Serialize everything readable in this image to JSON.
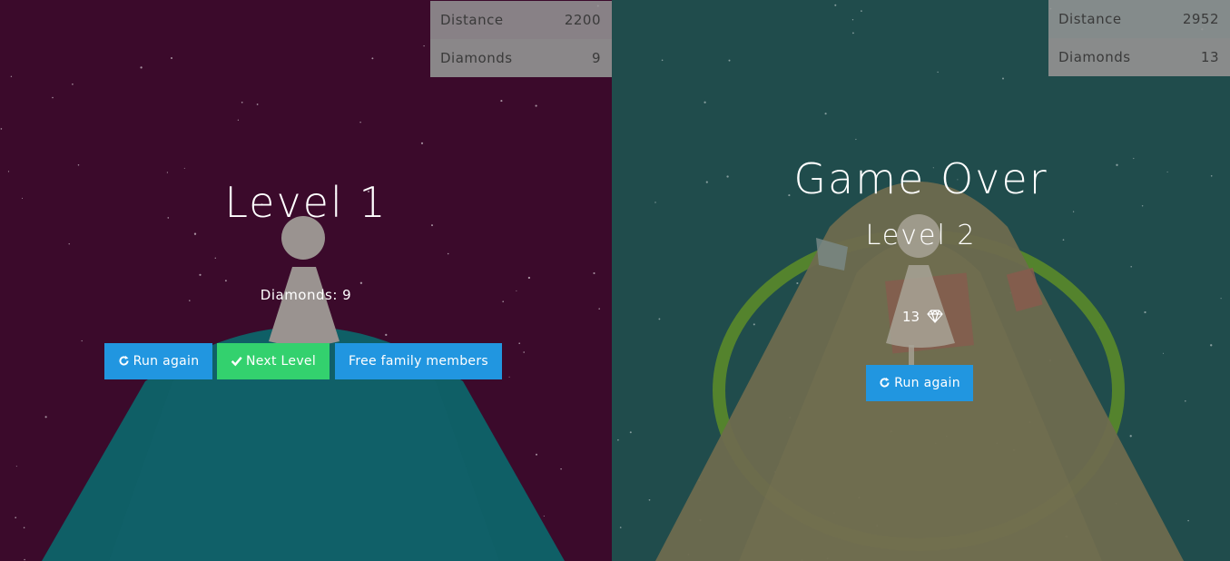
{
  "left": {
    "hud": {
      "distance_label": "Distance",
      "distance_value": "2200",
      "diamonds_label": "Diamonds",
      "diamonds_value": "9"
    },
    "title": "Level 1",
    "diamonds_line": "Diamonds: 9",
    "buttons": {
      "run_again": "Run again",
      "next_level": "Next Level",
      "free_family": "Free family members"
    }
  },
  "right": {
    "hud": {
      "distance_label": "Distance",
      "distance_value": "2952",
      "diamonds_label": "Diamonds",
      "diamonds_value": "13"
    },
    "title": "Game Over",
    "subtitle": "Level 2",
    "diamond_count": "13",
    "buttons": {
      "run_again": "Run again"
    }
  },
  "colors": {
    "left_bg": "#3b0a2b",
    "right_bg": "#204c4c",
    "button_blue": "#2196e0",
    "button_green": "#33d16e",
    "ring_green": "#5a8a2a"
  },
  "icons": [
    "refresh-icon",
    "check-icon",
    "diamond-icon"
  ]
}
